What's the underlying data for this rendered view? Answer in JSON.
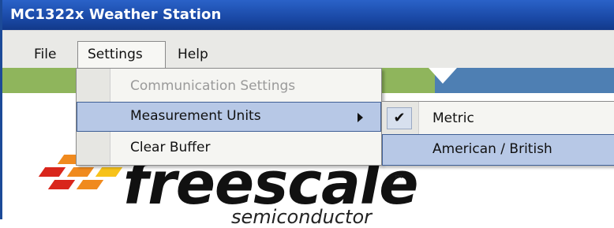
{
  "window": {
    "title": "MC1322x Weather Station"
  },
  "menubar": {
    "items": [
      "File",
      "Settings",
      "Help"
    ]
  },
  "settings_menu": {
    "items": [
      {
        "label": "Communication Settings",
        "enabled": false
      },
      {
        "label": "Measurement Units",
        "enabled": true,
        "has_submenu": true,
        "highlighted": true
      },
      {
        "label": "Clear Buffer",
        "enabled": true
      }
    ]
  },
  "units_submenu": {
    "items": [
      {
        "label": "Metric",
        "checked": true,
        "check_glyph": "✔"
      },
      {
        "label": "American / British",
        "checked": false,
        "highlighted": true
      }
    ]
  },
  "logo": {
    "name": "freescale",
    "tm": "™",
    "tagline": "semiconductor"
  },
  "colors": {
    "titlebar": "#1a49a6",
    "menu_highlight": "#b7c8e6",
    "banner_green": "#8fb55c",
    "banner_blue": "#4e7fb3",
    "logo_orange": "#f08a1e",
    "logo_yellow": "#f7c21a",
    "logo_red": "#d9261c"
  }
}
